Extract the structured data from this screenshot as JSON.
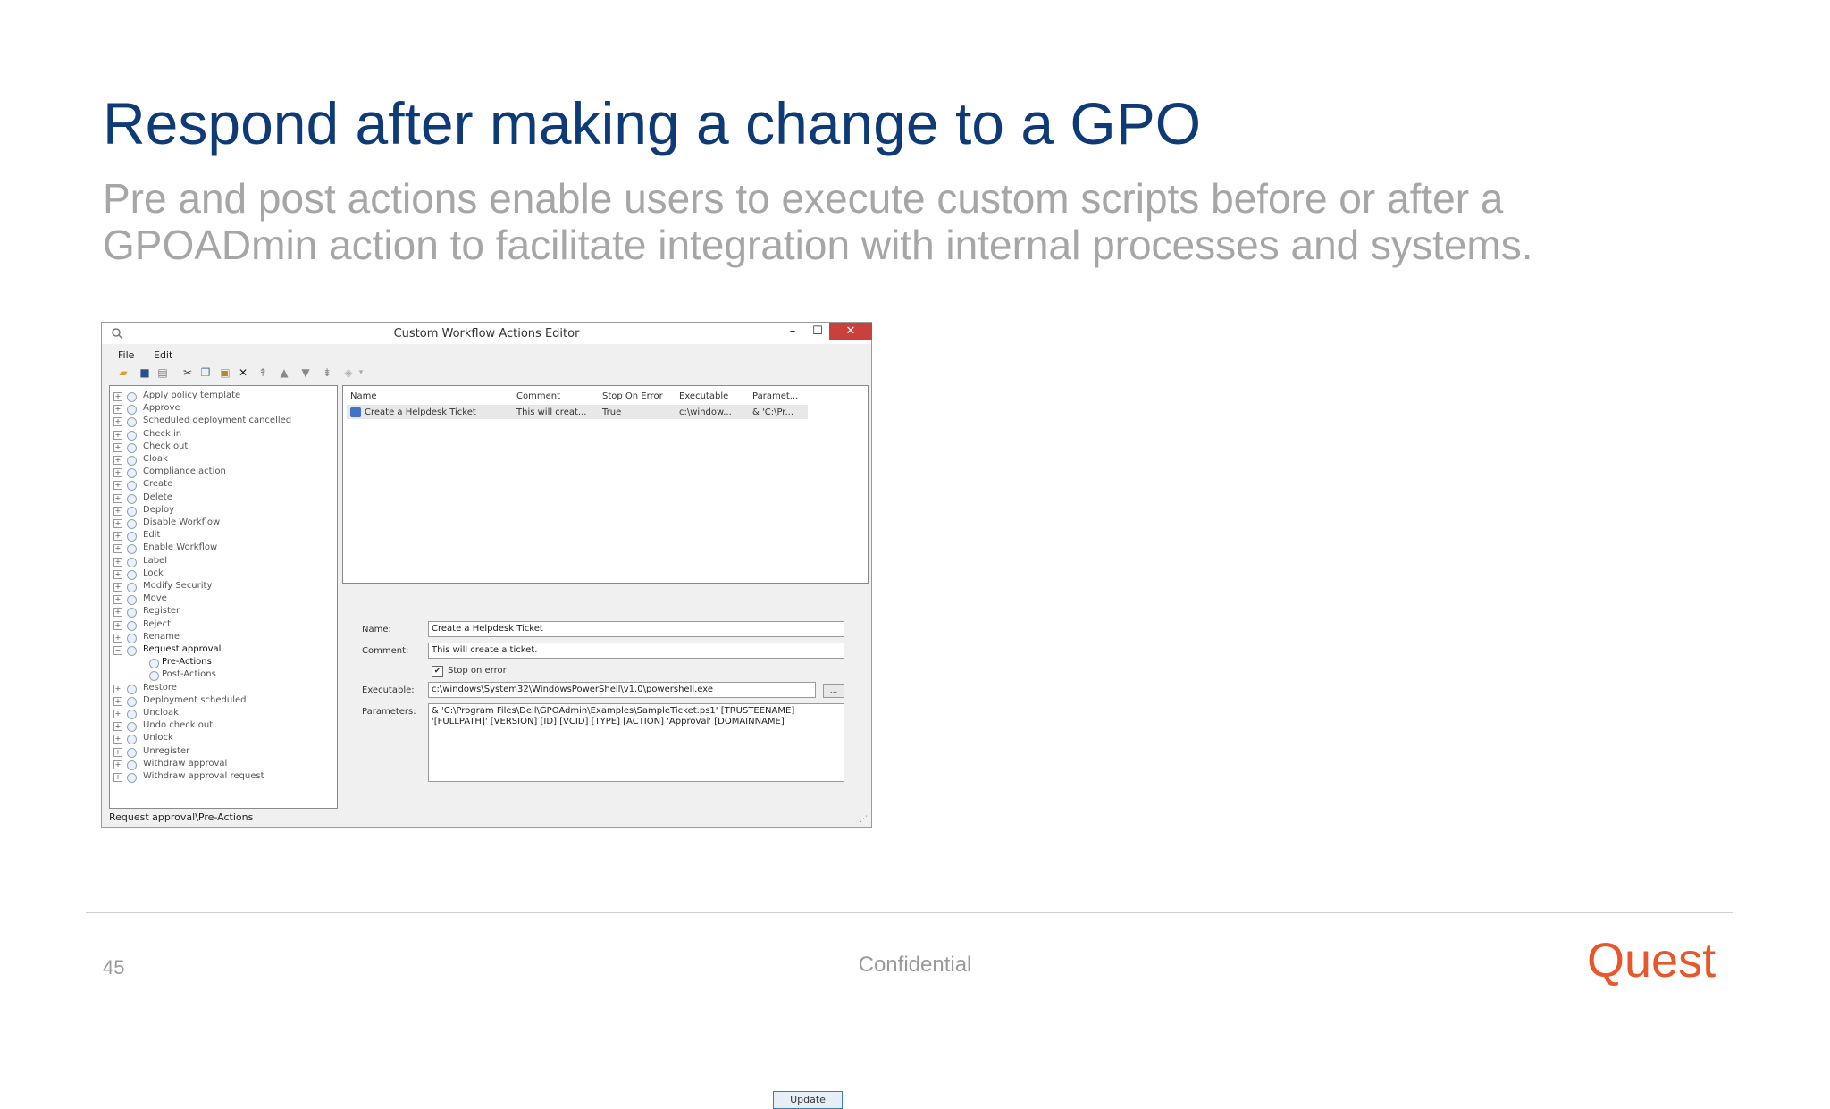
{
  "slide": {
    "title": "Respond after making a change to a GPO",
    "subtitle_line1": "Pre and post actions enable users to execute custom scripts before or after a",
    "subtitle_line2": "GPOADmin action to facilitate integration with internal processes and systems.",
    "page_number": "45",
    "footer_text": "Confidential",
    "brand": "Quest",
    "brand_color": "#e8572a",
    "title_color": "#0e3a78"
  },
  "window": {
    "title": "Custom Workflow Actions Editor",
    "minimize": "–",
    "maximize": "☐",
    "close": "✕",
    "menu": [
      "File",
      "Edit"
    ],
    "tree": [
      {
        "label": "Apply policy template",
        "expander": "+"
      },
      {
        "label": "Approve",
        "expander": "+"
      },
      {
        "label": "Scheduled deployment cancelled",
        "expander": "+"
      },
      {
        "label": "Check in",
        "expander": "+"
      },
      {
        "label": "Check out",
        "expander": "+"
      },
      {
        "label": "Cloak",
        "expander": "+"
      },
      {
        "label": "Compliance action",
        "expander": "+"
      },
      {
        "label": "Create",
        "expander": "+"
      },
      {
        "label": "Delete",
        "expander": "+"
      },
      {
        "label": "Deploy",
        "expander": "+"
      },
      {
        "label": "Disable Workflow",
        "expander": "+"
      },
      {
        "label": "Edit",
        "expander": "+"
      },
      {
        "label": "Enable Workflow",
        "expander": "+"
      },
      {
        "label": "Label",
        "expander": "+"
      },
      {
        "label": "Lock",
        "expander": "+"
      },
      {
        "label": "Modify Security",
        "expander": "+"
      },
      {
        "label": "Move",
        "expander": "+"
      },
      {
        "label": "Register",
        "expander": "+"
      },
      {
        "label": "Reject",
        "expander": "+"
      },
      {
        "label": "Rename",
        "expander": "+"
      },
      {
        "label": "Request approval",
        "expander": "−"
      },
      {
        "label": "Pre-Actions",
        "expander": ""
      },
      {
        "label": "Post-Actions",
        "expander": ""
      },
      {
        "label": "Restore",
        "expander": "+"
      },
      {
        "label": "Deployment scheduled",
        "expander": "+"
      },
      {
        "label": "Uncloak",
        "expander": "+"
      },
      {
        "label": "Undo check out",
        "expander": "+"
      },
      {
        "label": "Unlock",
        "expander": "+"
      },
      {
        "label": "Unregister",
        "expander": "+"
      },
      {
        "label": "Withdraw approval",
        "expander": "+"
      },
      {
        "label": "Withdraw approval request",
        "expander": "+"
      }
    ],
    "grid": {
      "headers": [
        "Name",
        "Comment",
        "Stop On Error",
        "Executable",
        "Paramet..."
      ],
      "row": [
        "Create a Helpdesk Ticket",
        "This will creat...",
        "True",
        "c:\\window...",
        "& 'C:\\Pr..."
      ]
    },
    "form": {
      "name_label": "Name:",
      "name_value": "Create a Helpdesk Ticket",
      "comment_label": "Comment:",
      "comment_value": "This will create a ticket.",
      "stop_on_error_label": "Stop on error",
      "stop_on_error_checked": "✔",
      "executable_label": "Executable:",
      "executable_value": "c:\\windows\\System32\\WindowsPowerShell\\v1.0\\powershell.exe",
      "browse_label": "...",
      "parameters_label": "Parameters:",
      "parameters_line1": "& 'C:\\Program Files\\Dell\\GPOAdmin\\Examples\\SampleTicket.ps1' [TRUSTEENAME]",
      "parameters_line2": "'[FULLPATH]' [VERSION] [ID] [VCID] [TYPE] [ACTION] 'Approval' [DOMAINNAME]",
      "update_label": "Update"
    },
    "status": "Request approval\\Pre-Actions"
  }
}
